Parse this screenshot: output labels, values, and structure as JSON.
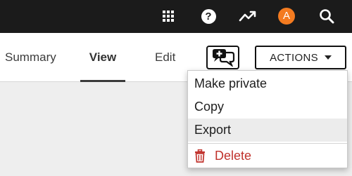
{
  "topbar": {
    "icons": [
      "apps-grid-icon",
      "help-icon",
      "activity-chart-icon",
      "user-avatar",
      "search-icon"
    ],
    "help_glyph": "?",
    "avatar_initial": "A",
    "avatar_color": "#f47b20"
  },
  "tabs": [
    {
      "label": "Summary",
      "active": false
    },
    {
      "label": "View",
      "active": true
    },
    {
      "label": "Edit",
      "active": false
    }
  ],
  "toolbar": {
    "actions_label": "ACTIONS",
    "chat_icon": "chat-add-icon"
  },
  "actions_menu": {
    "items": [
      {
        "label": "Make private",
        "state": "normal"
      },
      {
        "label": "Copy",
        "state": "normal"
      },
      {
        "label": "Export",
        "state": "hover"
      },
      {
        "label": "Delete",
        "state": "danger",
        "icon": "trash-icon",
        "color": "#c0322c"
      }
    ]
  }
}
